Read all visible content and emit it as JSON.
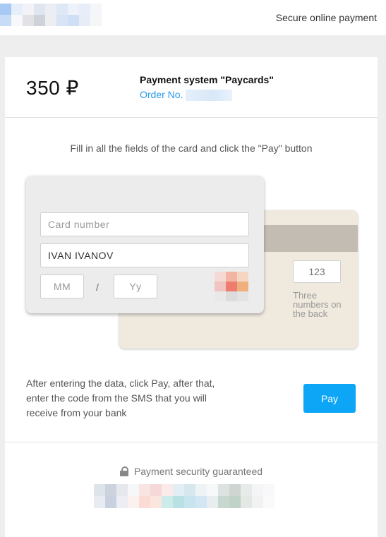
{
  "header": {
    "secure_label": "Secure online payment",
    "logo_colors": [
      "#a9c9f5",
      "#e6eefb",
      "#f1f3f7",
      "#e0e6ef",
      "#ebeff5",
      "#dfe8f7",
      "#eef3fb",
      "#e8eef8",
      "#f4f6fa",
      "#c7dcf7",
      "#f7f8fa",
      "#e2e2e6",
      "#cfd3d9",
      "#eceef2",
      "#d8e3f5",
      "#cfdff6",
      "#e7edf7",
      "#f5f6f8"
    ]
  },
  "summary": {
    "amount": "350 ₽",
    "payment_system": "Payment system \"Paycards\"",
    "order_label": "Order No."
  },
  "form": {
    "instruction": "Fill in all the fields of the card and click the \"Pay\" button",
    "card_number_placeholder": "Card number",
    "card_holder_value": "IVAN IVANOV",
    "month_placeholder": "MM",
    "date_separator": "/",
    "year_placeholder": "Yy",
    "cvv_placeholder": "123",
    "cvv_hint": "Three numbers on the back",
    "brand_colors": [
      "#f6d9d6",
      "#f2b5a4",
      "#f5d6c3",
      "#f0c4c1",
      "#ee7d70",
      "#f0b07d",
      "#e9e9e9",
      "#dcdcdc",
      "#e3e3e3"
    ]
  },
  "footer_action": {
    "note": "After entering the data, click Pay, after that, enter the code from the SMS that you will receive from your bank",
    "pay_label": "Pay"
  },
  "security": {
    "label": "Payment security guaranteed",
    "logo_colors": [
      "#dfe3ea",
      "#cdd3de",
      "#e6e8ee",
      "#f6f7f8",
      "#f9e4e4",
      "#f5d8d8",
      "#fbeaea",
      "#e2eef3",
      "#d6e8ee",
      "#eef4f6",
      "#f6f8f9",
      "#dde3e0",
      "#cfd6d2",
      "#e7ebe9",
      "#f4f5f6",
      "#f8f8f8",
      "#ffffff",
      "#e8ebf1",
      "#c9d0e0",
      "#eceef3",
      "#fbf1ee",
      "#fadcd4",
      "#fbe6df",
      "#ccebeb",
      "#b9e0e2",
      "#c8e4ef",
      "#d2e6f3",
      "#e8eef0",
      "#c8d7cf",
      "#bfd3c8",
      "#e3e8e5",
      "#f1f3f2",
      "#fafafa",
      "#ffffff"
    ]
  }
}
